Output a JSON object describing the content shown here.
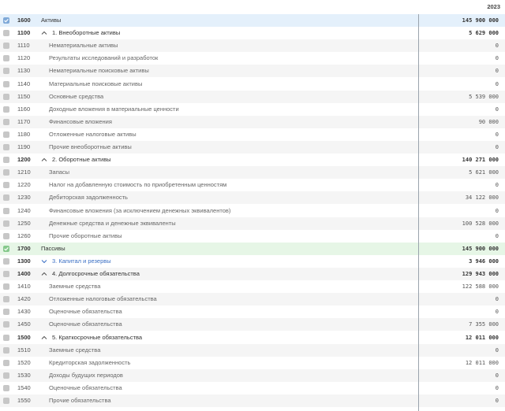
{
  "header": {
    "year": "2023"
  },
  "rows": [
    {
      "code": "1600",
      "label": "Активы",
      "value": "145 900 000",
      "type": "assets"
    },
    {
      "code": "1100",
      "label": "1. Внеоборотные активы",
      "value": "5 629 000",
      "type": "section",
      "caret": "up"
    },
    {
      "code": "1110",
      "label": "Нематериальные активы",
      "value": "0",
      "type": "item"
    },
    {
      "code": "1120",
      "label": "Результаты исследований и разработок",
      "value": "0",
      "type": "item"
    },
    {
      "code": "1130",
      "label": "Нематериальные поисковые активы",
      "value": "0",
      "type": "item"
    },
    {
      "code": "1140",
      "label": "Материальные поисковые активы",
      "value": "0",
      "type": "item"
    },
    {
      "code": "1150",
      "label": "Основные средства",
      "value": "5 539 000",
      "type": "item"
    },
    {
      "code": "1160",
      "label": "Доходные вложения в материальные ценности",
      "value": "0",
      "type": "item"
    },
    {
      "code": "1170",
      "label": "Финансовые вложения",
      "value": "90 000",
      "type": "item"
    },
    {
      "code": "1180",
      "label": "Отложенные налоговые активы",
      "value": "0",
      "type": "item"
    },
    {
      "code": "1190",
      "label": "Прочие внеоборотные активы",
      "value": "0",
      "type": "item"
    },
    {
      "code": "1200",
      "label": "2. Оборотные активы",
      "value": "140 271 000",
      "type": "section",
      "caret": "up"
    },
    {
      "code": "1210",
      "label": "Запасы",
      "value": "5 621 000",
      "type": "item"
    },
    {
      "code": "1220",
      "label": "Налог на добавленную стоимость по приобретенным ценностям",
      "value": "0",
      "type": "item"
    },
    {
      "code": "1230",
      "label": "Дебиторская задолженность",
      "value": "34 122 000",
      "type": "item"
    },
    {
      "code": "1240",
      "label": "Финансовые вложения (за исключением денежных эквивалентов)",
      "value": "0",
      "type": "item"
    },
    {
      "code": "1250",
      "label": "Денежные средства и денежные эквиваленты",
      "value": "100 528 000",
      "type": "item"
    },
    {
      "code": "1260",
      "label": "Прочие оборотные активы",
      "value": "0",
      "type": "item"
    },
    {
      "code": "1700",
      "label": "Пассивы",
      "value": "145 900 000",
      "type": "liab"
    },
    {
      "code": "1300",
      "label": "3. Капитал и резервы",
      "value": "3 946 000",
      "type": "section-collapsed",
      "caret": "down"
    },
    {
      "code": "1400",
      "label": "4. Долгосрочные обязательства",
      "value": "129 943 000",
      "type": "section",
      "caret": "up"
    },
    {
      "code": "1410",
      "label": "Заемные средства",
      "value": "122 588 000",
      "type": "item"
    },
    {
      "code": "1420",
      "label": "Отложенные налоговые обязательства",
      "value": "0",
      "type": "item"
    },
    {
      "code": "1430",
      "label": "Оценочные обязательства",
      "value": "0",
      "type": "item"
    },
    {
      "code": "1450",
      "label": "Оценочные обязательства",
      "value": "7 355 000",
      "type": "item"
    },
    {
      "code": "1500",
      "label": "5. Краткосрочные обязательства",
      "value": "12 011 000",
      "type": "section",
      "caret": "up"
    },
    {
      "code": "1510",
      "label": "Заемные средства",
      "value": "0",
      "type": "item"
    },
    {
      "code": "1520",
      "label": "Кредиторская задолженность",
      "value": "12 011 000",
      "type": "item"
    },
    {
      "code": "1530",
      "label": "Доходы будущих периодов",
      "value": "0",
      "type": "item"
    },
    {
      "code": "1540",
      "label": "Оценочные обязательства",
      "value": "0",
      "type": "item"
    },
    {
      "code": "1550",
      "label": "Прочие обязательства",
      "value": "0",
      "type": "item"
    }
  ]
}
